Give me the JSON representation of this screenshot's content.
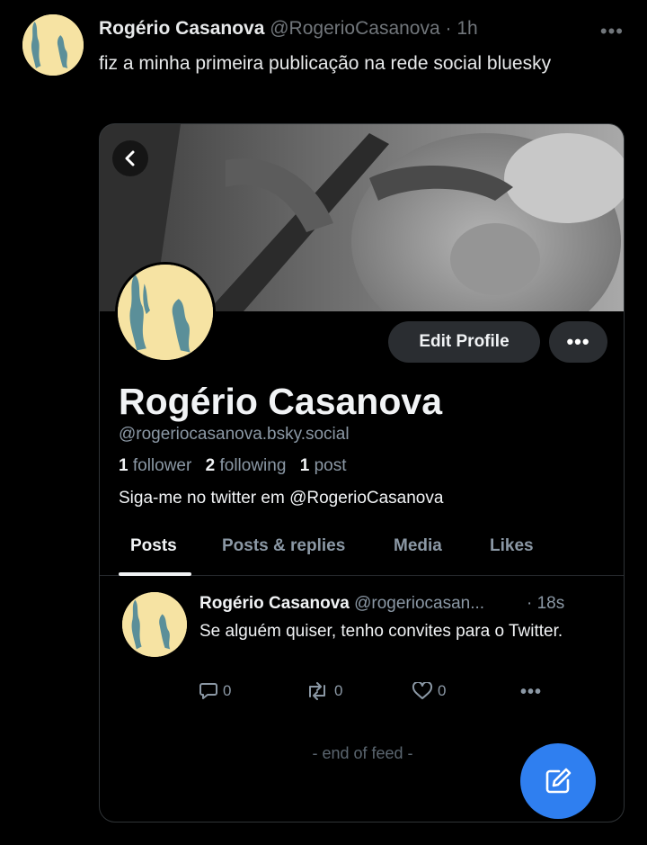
{
  "tweet": {
    "author_name": "Rogério Casanova",
    "author_handle": "@RogerioCasanova",
    "separator": "·",
    "time": "1h",
    "more_icon": "more-horizontal-icon",
    "text": "fiz a minha primeira publicação na rede social bluesky"
  },
  "card": {
    "back_icon": "chevron-left-icon",
    "edit_profile_label": "Edit Profile",
    "more_icon": "more-horizontal-icon",
    "profile": {
      "name": "Rogério Casanova",
      "handle": "@rogeriocasanova.bsky.social",
      "followers_count": "1",
      "followers_label": "follower",
      "following_count": "2",
      "following_label": "following",
      "posts_count": "1",
      "posts_label": "post",
      "bio": "Siga-me no twitter em @RogerioCasanova"
    },
    "tabs": [
      {
        "label": "Posts",
        "active": true
      },
      {
        "label": "Posts & replies",
        "active": false
      },
      {
        "label": "Media",
        "active": false
      },
      {
        "label": "Likes",
        "active": false
      }
    ],
    "post": {
      "author_name": "Rogério Casanova",
      "author_handle": "@rogeriocasan...",
      "separator": "·",
      "time": "18s",
      "text": "Se alguém quiser, tenho convites para o Twitter.",
      "reply_count": "0",
      "repost_count": "0",
      "like_count": "0",
      "reply_icon": "reply-icon",
      "repost_icon": "repost-icon",
      "like_icon": "heart-icon",
      "more_icon": "more-horizontal-icon"
    },
    "end_of_feed": "- end of feed -",
    "compose_icon": "compose-icon"
  },
  "colors": {
    "background": "#000000",
    "accent_blue": "#2f7ff0",
    "avatar_bg": "#f6e3a3",
    "avatar_teal": "#5b8f99",
    "muted_text": "#8b98a5"
  }
}
